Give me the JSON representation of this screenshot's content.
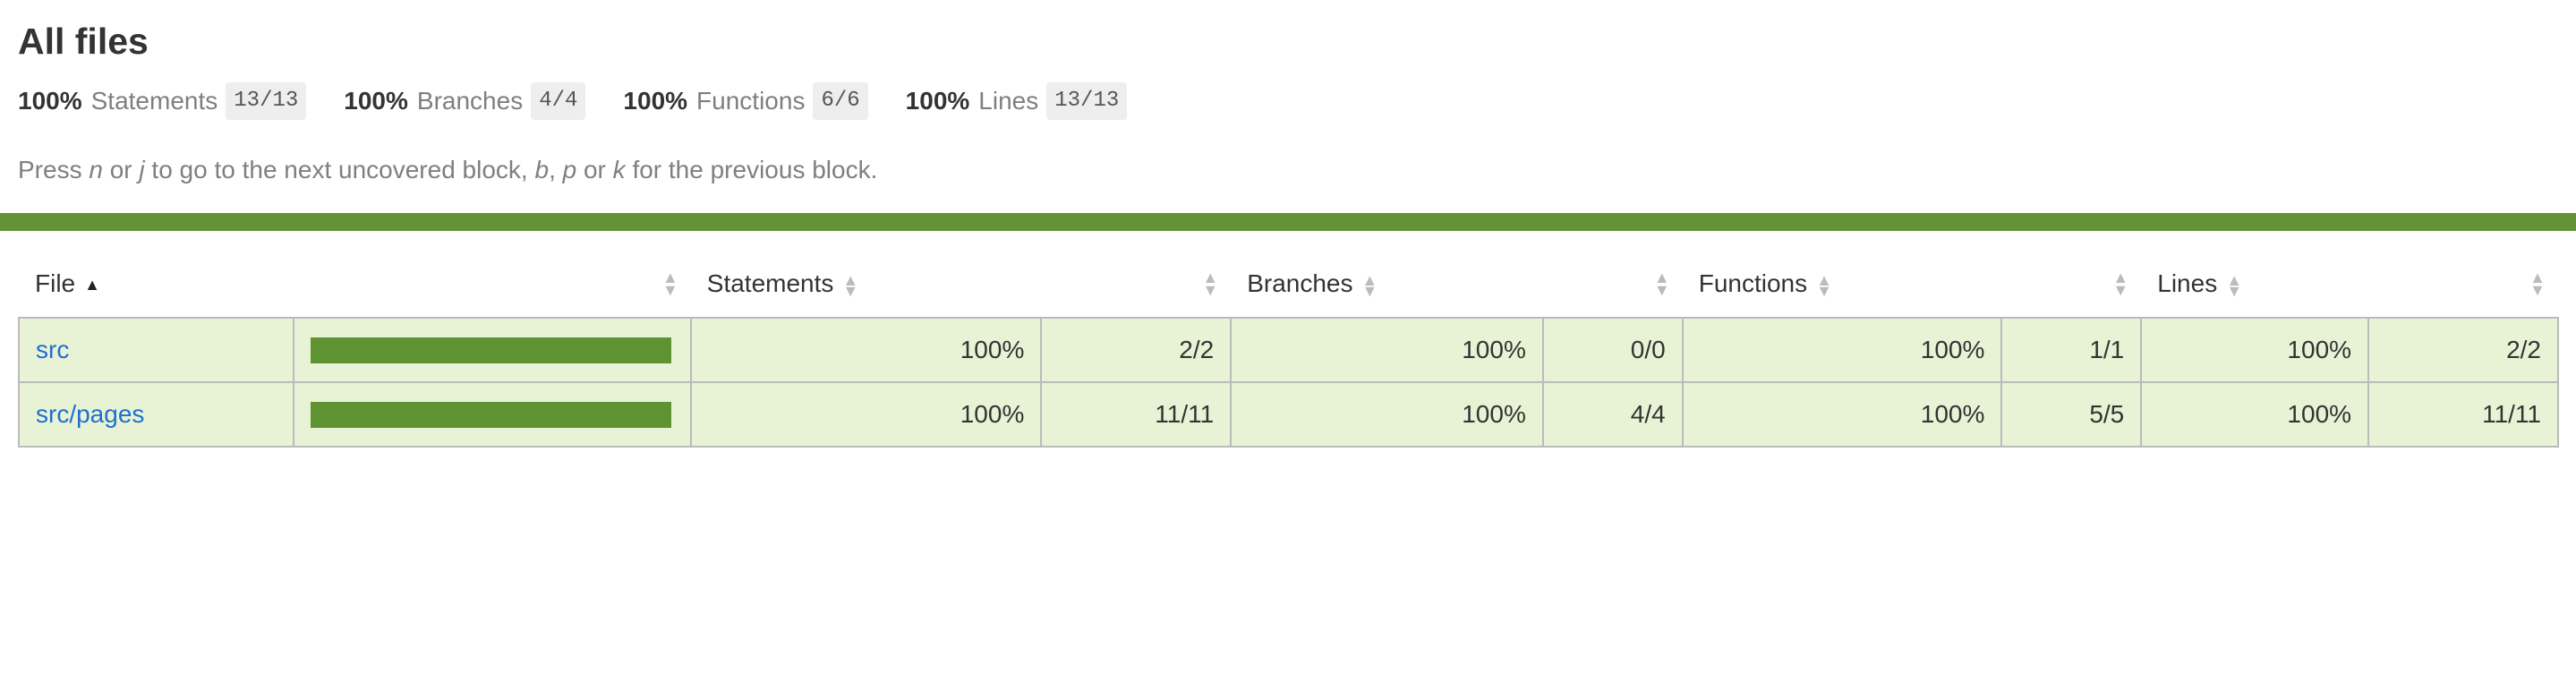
{
  "page": {
    "title": "All files",
    "hint_parts": [
      "Press ",
      "n",
      " or ",
      "j",
      " to go to the next uncovered block, ",
      "b",
      ", ",
      "p",
      " or ",
      "k",
      " for the previous block."
    ]
  },
  "summary": [
    {
      "pct": "100%",
      "label": "Statements",
      "fraction": "13/13"
    },
    {
      "pct": "100%",
      "label": "Branches",
      "fraction": "4/4"
    },
    {
      "pct": "100%",
      "label": "Functions",
      "fraction": "6/6"
    },
    {
      "pct": "100%",
      "label": "Lines",
      "fraction": "13/13"
    }
  ],
  "colors": {
    "status_high": "#649237",
    "row_bg": "#e8f3d5",
    "link": "#1f6fd0"
  },
  "table": {
    "headers": {
      "file": "File",
      "statements": "Statements",
      "branches": "Branches",
      "functions": "Functions",
      "lines": "Lines"
    },
    "rows": [
      {
        "file": "src",
        "coverage_fraction": 1.0,
        "statements_pct": "100%",
        "statements_frac": "2/2",
        "branches_pct": "100%",
        "branches_frac": "0/0",
        "functions_pct": "100%",
        "functions_frac": "1/1",
        "lines_pct": "100%",
        "lines_frac": "2/2"
      },
      {
        "file": "src/pages",
        "coverage_fraction": 1.0,
        "statements_pct": "100%",
        "statements_frac": "11/11",
        "branches_pct": "100%",
        "branches_frac": "4/4",
        "functions_pct": "100%",
        "functions_frac": "5/5",
        "lines_pct": "100%",
        "lines_frac": "11/11"
      }
    ]
  }
}
